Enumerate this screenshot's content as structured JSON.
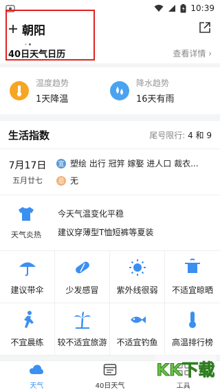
{
  "status_bar": {
    "time": "10:39"
  },
  "header": {
    "add_icon": "plus-icon",
    "city": "朝阳",
    "calendar_title": "40日天气日历",
    "detail_link": "查看详情"
  },
  "trends": [
    {
      "title": "温度趋势",
      "value": "1天降温",
      "icon": "thermometer-icon",
      "color": "#f6a623"
    },
    {
      "title": "降水趋势",
      "value": "16天有雨",
      "icon": "raindrops-icon",
      "color": "#4aa3f0"
    }
  ],
  "life": {
    "title": "生活指数",
    "limit_label": "尾号限行:",
    "limit_value": "4 和 9",
    "almanac": {
      "date": "7月17日",
      "lunar": "五月廿七",
      "yi_badge": "宜",
      "yi": "塑绘 出行 冠笄 嫁娶 进人口 裁衣...",
      "ji_badge": "忌",
      "ji": "无"
    },
    "advice": {
      "label": "天气炎热",
      "line1": "今天气温变化平稳",
      "line2": "建议穿薄型T恤短裤等夏装"
    },
    "grid": [
      {
        "label": "建议带伞",
        "icon": "umbrella-icon"
      },
      {
        "label": "少发感冒",
        "icon": "pill-icon"
      },
      {
        "label": "紫外线很弱",
        "icon": "sun-icon"
      },
      {
        "label": "不适宜晾晒",
        "icon": "clothes-hanger-icon"
      },
      {
        "label": "不宜晨练",
        "icon": "running-icon"
      },
      {
        "label": "较不适宜旅游",
        "icon": "palm-tree-icon"
      },
      {
        "label": "不适宜钓鱼",
        "icon": "fish-icon"
      },
      {
        "label": "高温排行榜",
        "icon": "thermometer-icon"
      }
    ]
  },
  "tabs": [
    {
      "label": "天气",
      "active": true
    },
    {
      "label": "40日天气",
      "active": false
    },
    {
      "label": "工具",
      "active": false
    }
  ],
  "watermark": "KK下载",
  "colors": {
    "accent": "#3b8ff0",
    "highlight": "#e02020"
  }
}
